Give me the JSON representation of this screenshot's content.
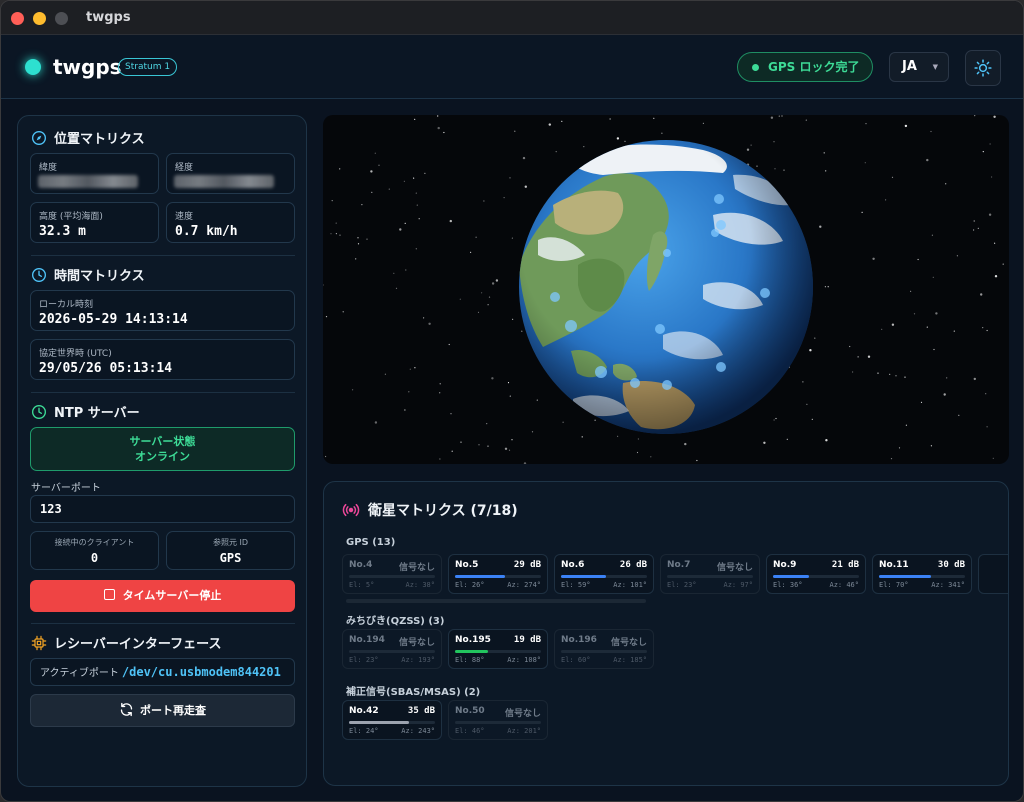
{
  "window": {
    "title": "twgps"
  },
  "header": {
    "logo": "twgps",
    "stratum": "Stratum 1",
    "gps_lock": "GPS ロック完了",
    "lang": "JA"
  },
  "position": {
    "title": "位置マトリクス",
    "lat_label": "緯度",
    "lon_label": "経度",
    "alt_label": "高度 (平均海面)",
    "alt_value": "32.3 m",
    "speed_label": "速度",
    "speed_value": "0.7 km/h"
  },
  "time": {
    "title": "時間マトリクス",
    "local_label": "ローカル時刻",
    "local_value": "2026-05-29 14:13:14",
    "utc_label": "協定世界時 (UTC)",
    "utc_value": "29/05/26 05:13:14"
  },
  "ntp": {
    "title": "NTP サーバー",
    "status_line1": "サーバー状態",
    "status_line2": "オンライン",
    "port_label": "サーバーポート",
    "port_value": "123",
    "clients_label": "接続中のクライアント",
    "clients_value": "0",
    "ref_label": "参照元 ID",
    "ref_value": "GPS",
    "stop_button": "タイムサーバー停止"
  },
  "receiver": {
    "title": "レシーバーインターフェース",
    "active_label": "アクティブポート",
    "active_path": "/dev/cu.usbmodem844201",
    "rescan_button": "ポート再走査"
  },
  "satellites": {
    "title": "衛星マトリクス (7/18)",
    "colors": {
      "gps": "#3b82f6",
      "qzss": "#22c55e",
      "sbas": "#9ca3af"
    },
    "groups": [
      {
        "name": "GPS (13)",
        "sats": [
          {
            "no": "No.4",
            "db": "信号なし",
            "el": "El: 5°",
            "az": "Az: 38°",
            "active": false,
            "signal": 0
          },
          {
            "no": "No.5",
            "db": "29 dB",
            "el": "El: 26°",
            "az": "Az: 274°",
            "active": true,
            "signal": 0.58
          },
          {
            "no": "No.6",
            "db": "26 dB",
            "el": "El: 59°",
            "az": "Az: 101°",
            "active": true,
            "signal": 0.52
          },
          {
            "no": "No.7",
            "db": "信号なし",
            "el": "El: 23°",
            "az": "Az: 97°",
            "active": false,
            "signal": 0
          },
          {
            "no": "No.9",
            "db": "21 dB",
            "el": "El: 36°",
            "az": "Az: 46°",
            "active": true,
            "signal": 0.42
          },
          {
            "no": "No.11",
            "db": "30 dB",
            "el": "El: 70°",
            "az": "Az: 341°",
            "active": true,
            "signal": 0.6
          }
        ]
      },
      {
        "name": "みちびき(QZSS) (3)",
        "sats": [
          {
            "no": "No.194",
            "db": "信号なし",
            "el": "El: 23°",
            "az": "Az: 193°",
            "active": false,
            "signal": 0
          },
          {
            "no": "No.195",
            "db": "19 dB",
            "el": "El: 88°",
            "az": "Az: 108°",
            "active": true,
            "signal": 0.38
          },
          {
            "no": "No.196",
            "db": "信号なし",
            "el": "El: 60°",
            "az": "Az: 185°",
            "active": false,
            "signal": 0
          }
        ]
      },
      {
        "name": "補正信号(SBAS/MSAS) (2)",
        "sats": [
          {
            "no": "No.42",
            "db": "35 dB",
            "el": "El: 24°",
            "az": "Az: 243°",
            "active": true,
            "signal": 0.7
          },
          {
            "no": "No.50",
            "db": "信号なし",
            "el": "El: 46°",
            "az": "Az: 201°",
            "active": false,
            "signal": 0
          }
        ]
      }
    ]
  }
}
